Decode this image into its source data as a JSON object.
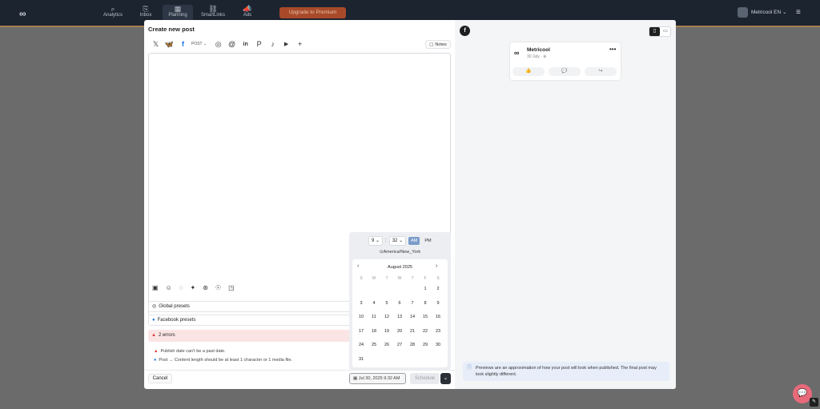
{
  "topbar": {
    "logo": "∞",
    "nav": [
      {
        "icon": "⌕",
        "label": "Analytics"
      },
      {
        "icon": "⎘",
        "label": "Inbox"
      },
      {
        "icon": "▦",
        "label": "Planning"
      },
      {
        "icon": "⛓",
        "label": "SmartLinks"
      },
      {
        "icon": "📣",
        "label": "Ads"
      }
    ],
    "upgrade_label": "Upgrade to Premium",
    "account_name": "Metricool EN",
    "account_caret": "⌄",
    "menu_icon": "≡"
  },
  "modal": {
    "title": "Create new post",
    "networks": [
      {
        "icon": "𝕏",
        "name": "x-icon"
      },
      {
        "icon": "🦋",
        "name": "bluesky-icon"
      },
      {
        "icon": "f",
        "name": "facebook-icon"
      },
      {
        "icon": "◎",
        "name": "instagram-icon"
      },
      {
        "icon": "@",
        "name": "threads-icon"
      },
      {
        "icon": "in",
        "name": "linkedin-icon"
      },
      {
        "icon": "P",
        "name": "pinterest-icon"
      },
      {
        "icon": "♪",
        "name": "tiktok-icon"
      },
      {
        "icon": "▶",
        "name": "youtube-icon"
      }
    ],
    "post_type": "POST",
    "add_network": "+",
    "notes_label": "Notes",
    "editor_tools": [
      "▣",
      "☺",
      "◌",
      "✦",
      "⊛",
      "☉",
      "◳"
    ],
    "global_presets": "Global presets",
    "facebook_presets": "Facebook presets",
    "errors_title": "2 errors",
    "errors": [
      "Publish date can't be a past date.",
      "Post → Content length should be at least 1 character or 1 media file."
    ],
    "cancel_label": "Cancel",
    "date_label": "Jul 30, 2025 9:32 AM",
    "schedule_label": "Schedule",
    "schedule_caret": "⌄"
  },
  "picker": {
    "hour": "9",
    "minute": "32",
    "am": "AM",
    "pm": "PM",
    "timezone": "America/New_York",
    "month": "August 2025",
    "weekdays": [
      "S",
      "M",
      "T",
      "W",
      "T",
      "F",
      "S"
    ],
    "days": [
      "",
      "",
      "",
      "",
      "",
      "1",
      "2",
      "3",
      "4",
      "5",
      "6",
      "7",
      "8",
      "9",
      "10",
      "11",
      "12",
      "13",
      "14",
      "15",
      "16",
      "17",
      "18",
      "19",
      "20",
      "21",
      "22",
      "23",
      "24",
      "25",
      "26",
      "27",
      "28",
      "29",
      "30",
      "31",
      "",
      "",
      "",
      "",
      "",
      ""
    ]
  },
  "preview": {
    "badge": "f",
    "account_name": "Metricool",
    "date": "30 July · ⊕",
    "more": "•••",
    "actions": [
      "👍",
      "💬",
      "↪"
    ],
    "note": "Previews are an approximation of how your post will look when published. The final post may look slightly different."
  },
  "chat_icon": "💬"
}
